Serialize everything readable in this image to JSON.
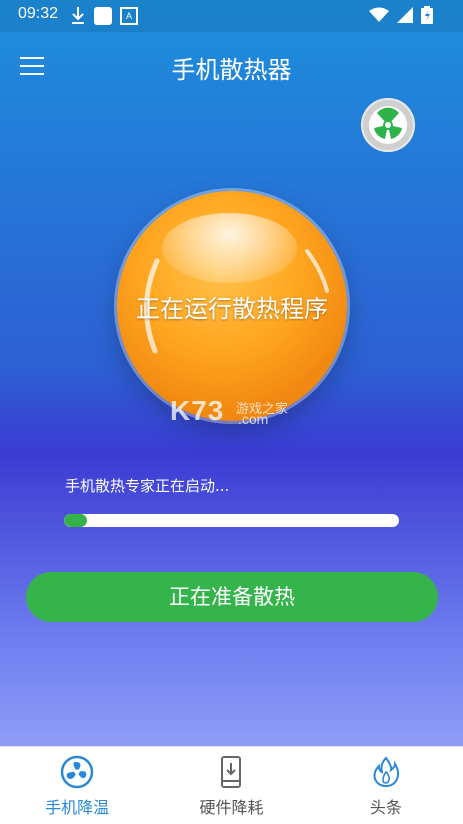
{
  "status_bar": {
    "time": "09:32",
    "notification_icons": [
      "download-icon",
      "square-icon",
      "a-icon"
    ],
    "right_icons": [
      "wifi-icon",
      "signal-icon",
      "battery-icon"
    ]
  },
  "header": {
    "title": "手机散热器",
    "menu_icon": "hamburger-icon",
    "fan_button_icon": "fan-icon"
  },
  "orb": {
    "text": "正在运行散热程序",
    "color": "#f79a1b"
  },
  "watermark": {
    "logo": "K73",
    "site_name": "游戏之家",
    "domain": ".com"
  },
  "progress": {
    "status_text": "手机散热专家正在启动...",
    "fraction": 0.07,
    "fill_color": "#36b24a"
  },
  "primary_button": {
    "label": "正在准备散热",
    "color": "#34b44a"
  },
  "bottom_nav": {
    "items": [
      {
        "label": "手机降温",
        "icon": "fan-icon",
        "active": true
      },
      {
        "label": "硬件降耗",
        "icon": "phone-download-icon",
        "active": false
      },
      {
        "label": "头条",
        "icon": "flame-icon",
        "active": false
      }
    ],
    "active_color": "#2a88d8"
  }
}
